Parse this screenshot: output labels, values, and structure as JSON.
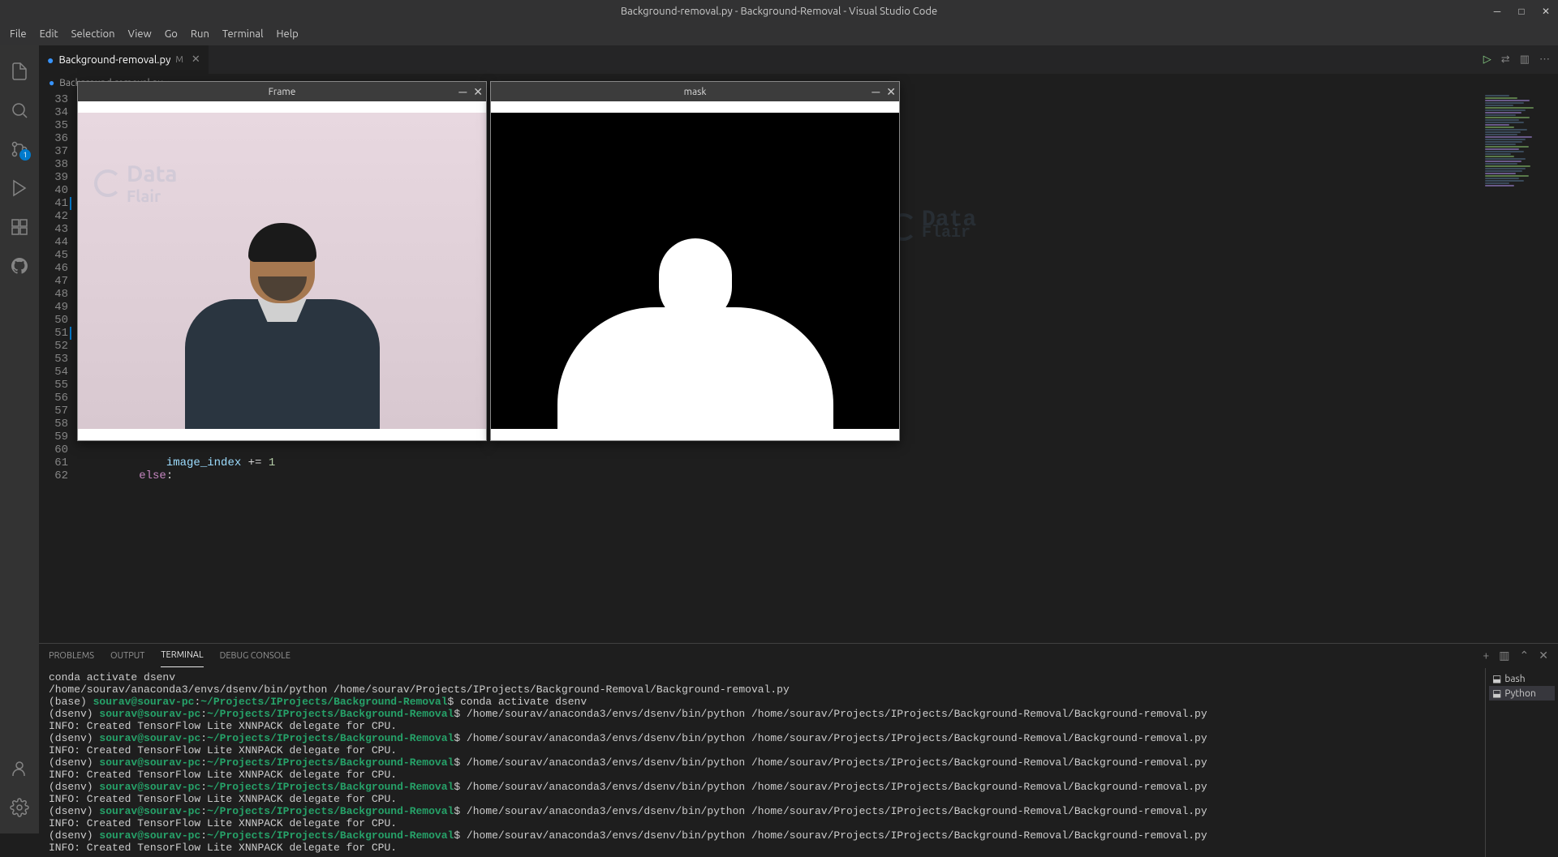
{
  "titlebar": {
    "title": "Background-removal.py - Background-Removal - Visual Studio Code"
  },
  "menu": {
    "file": "File",
    "edit": "Edit",
    "selection": "Selection",
    "view": "View",
    "go": "Go",
    "run": "Run",
    "terminal": "Terminal",
    "help": "Help"
  },
  "activity": {
    "scm_badge": "1"
  },
  "tab": {
    "filename": "Background-removal.py",
    "modified": "M"
  },
  "breadcrumb": {
    "file": "Background-removal.py",
    "sep": "›",
    "more": "..."
  },
  "gutter": {
    "start": 33,
    "end": 62,
    "highlighted": [
      41,
      51
    ]
  },
  "code": {
    "line61": "            image_index += 1",
    "line62_kw": "        else",
    "line62_colon": ":"
  },
  "windows": {
    "frame": {
      "title": "Frame"
    },
    "mask": {
      "title": "mask"
    }
  },
  "watermark": {
    "text": "Data\nFlair"
  },
  "panel": {
    "tabs": {
      "problems": "PROBLEMS",
      "output": "OUTPUT",
      "terminal": "TERMINAL",
      "debug": "DEBUG CONSOLE"
    },
    "terminals": {
      "bash": "bash",
      "python": "Python"
    }
  },
  "terminal_lines": [
    {
      "parts": [
        {
          "t": "plain",
          "v": "conda activate dsenv"
        }
      ]
    },
    {
      "parts": [
        {
          "t": "plain",
          "v": "/home/sourav/anaconda3/envs/dsenv/bin/python /home/sourav/Projects/IProjects/Background-Removal/Background-removal.py"
        }
      ]
    },
    {
      "parts": [
        {
          "t": "plain",
          "v": "(base) "
        },
        {
          "t": "user",
          "v": "sourav@sourav-pc"
        },
        {
          "t": "plain",
          "v": ":"
        },
        {
          "t": "path",
          "v": "~/Projects/IProjects/Background-Removal"
        },
        {
          "t": "plain",
          "v": "$ conda activate dsenv"
        }
      ]
    },
    {
      "parts": [
        {
          "t": "plain",
          "v": "(dsenv) "
        },
        {
          "t": "user",
          "v": "sourav@sourav-pc"
        },
        {
          "t": "plain",
          "v": ":"
        },
        {
          "t": "path",
          "v": "~/Projects/IProjects/Background-Removal"
        },
        {
          "t": "plain",
          "v": "$ /home/sourav/anaconda3/envs/dsenv/bin/python /home/sourav/Projects/IProjects/Background-Removal/Background-removal.py"
        }
      ]
    },
    {
      "parts": [
        {
          "t": "plain",
          "v": "INFO: Created TensorFlow Lite XNNPACK delegate for CPU."
        }
      ]
    },
    {
      "parts": [
        {
          "t": "plain",
          "v": "(dsenv) "
        },
        {
          "t": "user",
          "v": "sourav@sourav-pc"
        },
        {
          "t": "plain",
          "v": ":"
        },
        {
          "t": "path",
          "v": "~/Projects/IProjects/Background-Removal"
        },
        {
          "t": "plain",
          "v": "$ /home/sourav/anaconda3/envs/dsenv/bin/python /home/sourav/Projects/IProjects/Background-Removal/Background-removal.py"
        }
      ]
    },
    {
      "parts": [
        {
          "t": "plain",
          "v": "INFO: Created TensorFlow Lite XNNPACK delegate for CPU."
        }
      ]
    },
    {
      "parts": [
        {
          "t": "plain",
          "v": "(dsenv) "
        },
        {
          "t": "user",
          "v": "sourav@sourav-pc"
        },
        {
          "t": "plain",
          "v": ":"
        },
        {
          "t": "path",
          "v": "~/Projects/IProjects/Background-Removal"
        },
        {
          "t": "plain",
          "v": "$ /home/sourav/anaconda3/envs/dsenv/bin/python /home/sourav/Projects/IProjects/Background-Removal/Background-removal.py"
        }
      ]
    },
    {
      "parts": [
        {
          "t": "plain",
          "v": "INFO: Created TensorFlow Lite XNNPACK delegate for CPU."
        }
      ]
    },
    {
      "parts": [
        {
          "t": "plain",
          "v": "(dsenv) "
        },
        {
          "t": "user",
          "v": "sourav@sourav-pc"
        },
        {
          "t": "plain",
          "v": ":"
        },
        {
          "t": "path",
          "v": "~/Projects/IProjects/Background-Removal"
        },
        {
          "t": "plain",
          "v": "$ /home/sourav/anaconda3/envs/dsenv/bin/python /home/sourav/Projects/IProjects/Background-Removal/Background-removal.py"
        }
      ]
    },
    {
      "parts": [
        {
          "t": "plain",
          "v": "INFO: Created TensorFlow Lite XNNPACK delegate for CPU."
        }
      ]
    },
    {
      "parts": [
        {
          "t": "plain",
          "v": "(dsenv) "
        },
        {
          "t": "user",
          "v": "sourav@sourav-pc"
        },
        {
          "t": "plain",
          "v": ":"
        },
        {
          "t": "path",
          "v": "~/Projects/IProjects/Background-Removal"
        },
        {
          "t": "plain",
          "v": "$ /home/sourav/anaconda3/envs/dsenv/bin/python /home/sourav/Projects/IProjects/Background-Removal/Background-removal.py"
        }
      ]
    },
    {
      "parts": [
        {
          "t": "plain",
          "v": "INFO: Created TensorFlow Lite XNNPACK delegate for CPU."
        }
      ]
    },
    {
      "parts": [
        {
          "t": "plain",
          "v": "(dsenv) "
        },
        {
          "t": "user",
          "v": "sourav@sourav-pc"
        },
        {
          "t": "plain",
          "v": ":"
        },
        {
          "t": "path",
          "v": "~/Projects/IProjects/Background-Removal"
        },
        {
          "t": "plain",
          "v": "$ /home/sourav/anaconda3/envs/dsenv/bin/python /home/sourav/Projects/IProjects/Background-Removal/Background-removal.py"
        }
      ]
    },
    {
      "parts": [
        {
          "t": "plain",
          "v": "INFO: Created TensorFlow Lite XNNPACK delegate for CPU."
        }
      ]
    }
  ]
}
